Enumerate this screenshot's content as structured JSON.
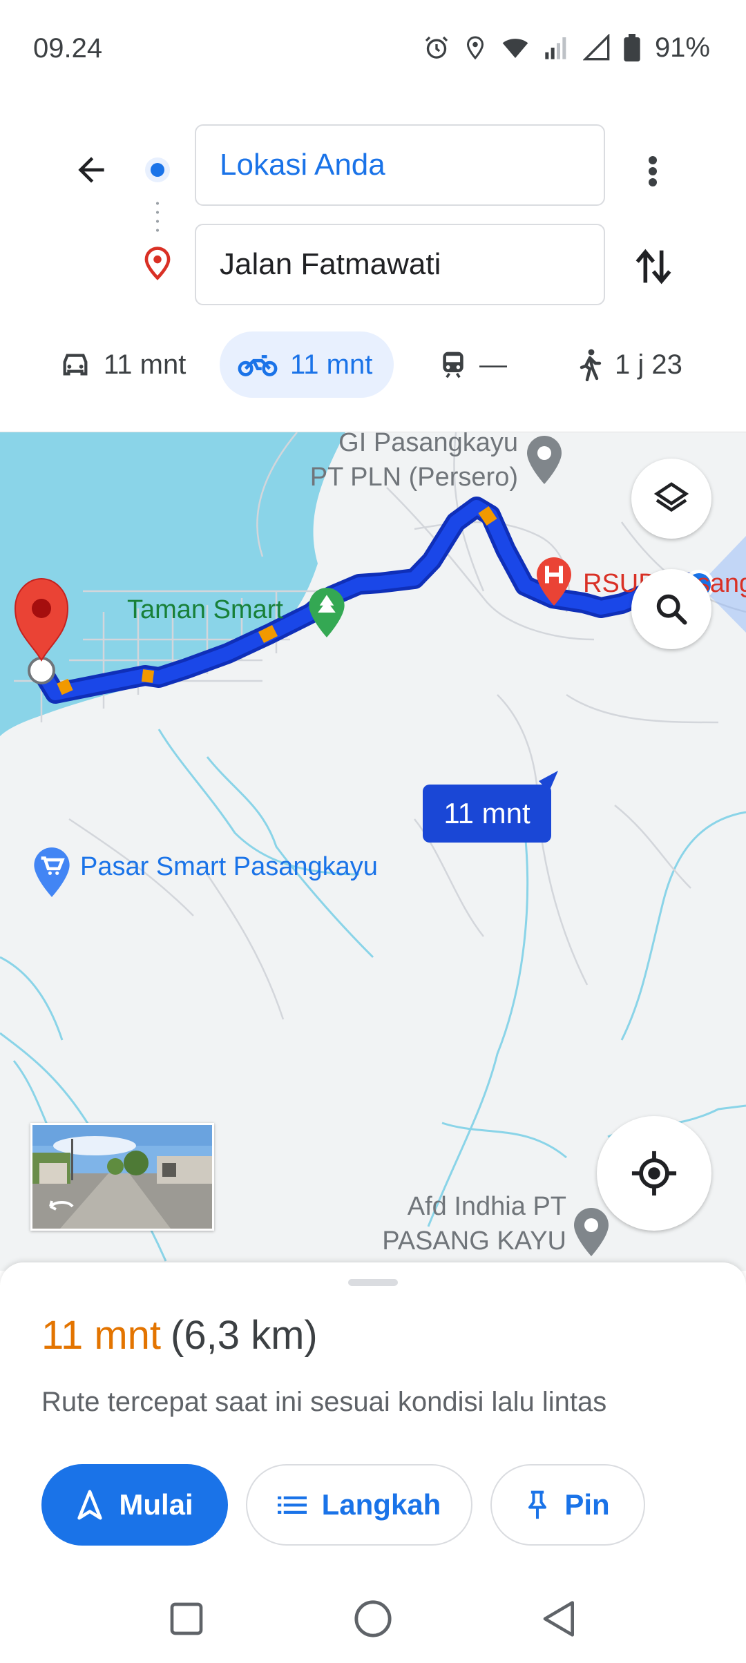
{
  "status_bar": {
    "time": "09.24",
    "battery_percent": "91%",
    "icons": [
      "alarm-icon",
      "location-icon",
      "wifi-icon",
      "signal-icon",
      "signal-icon",
      "battery-icon"
    ]
  },
  "search": {
    "origin": "Lokasi Anda",
    "destination": "Jalan Fatmawati"
  },
  "modes": [
    {
      "name": "car",
      "label": "11 mnt",
      "selected": false
    },
    {
      "name": "motorcycle",
      "label": "11 mnt",
      "selected": true
    },
    {
      "name": "transit",
      "label": "—",
      "selected": false
    },
    {
      "name": "walk",
      "label": "1 j 23",
      "selected": false
    }
  ],
  "map": {
    "places": {
      "gi_pasangkayu": "GI Pasangkayu\nPT PLN (Persero)",
      "taman_smart": "Taman Smart",
      "rsud": "RSUD Pasang",
      "pasar_smart": "Pasar Smart Pasangkayu",
      "afd_indhia": "Afd Indhia PT\nPASANG KAYU"
    },
    "route_label": "11 mnt",
    "colors": {
      "water": "#8ad4e8",
      "route": "#1a47e8",
      "traffic_slow": "#f29900",
      "land": "#f1f3f4"
    }
  },
  "sheet": {
    "duration": "11 mnt",
    "distance": "(6,3 km)",
    "description": "Rute tercepat saat ini sesuai kondisi lalu lintas",
    "buttons": {
      "start": "Mulai",
      "steps": "Langkah",
      "pin": "Pin"
    }
  }
}
